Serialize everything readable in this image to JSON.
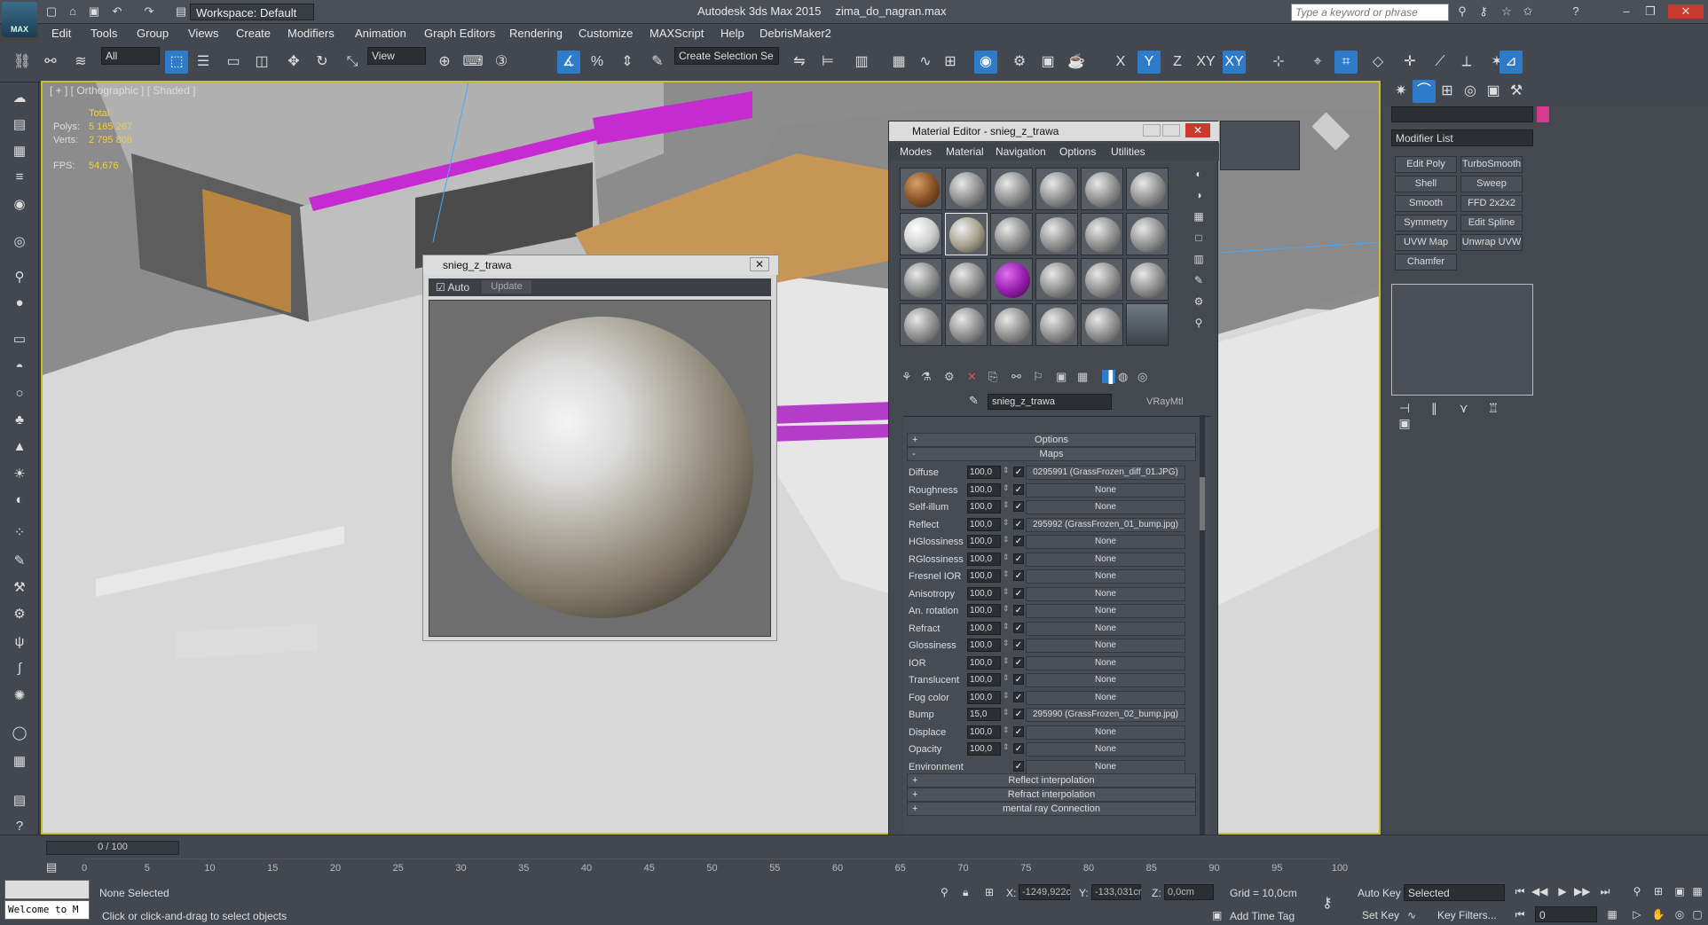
{
  "window": {
    "app_title": "Autodesk 3ds Max 2015",
    "file_name": "zima_do_nagran.max",
    "workspace": "Workspace: Default",
    "search_placeholder": "Type a keyword or phrase",
    "logo_text": "MAX"
  },
  "menus": [
    "Edit",
    "Tools",
    "Group",
    "Views",
    "Create",
    "Modifiers",
    "Animation",
    "Graph Editors",
    "Rendering",
    "Customize",
    "MAXScript",
    "Help",
    "DebrisMaker2"
  ],
  "main_toolbar": {
    "selection_filter": "All",
    "reference_coord": "View",
    "selection_set": "Create Selection Se",
    "axis_x": "X",
    "axis_y": "Y",
    "axis_z": "Z",
    "axis_xy": "XY",
    "axis_xy2": "XY"
  },
  "viewport": {
    "label": "[ + ] [ Orthographic ] [ Shaded ]",
    "stats": {
      "total_label": "Total",
      "polys_label": "Polys:",
      "polys_value": "5 165 267",
      "verts_label": "Verts:",
      "verts_value": "2 795 808",
      "fps_label": "FPS:",
      "fps_value": "54,676"
    }
  },
  "preview_window": {
    "title": "snieg_z_trawa",
    "auto_label": "Auto",
    "update_label": "Update"
  },
  "material_editor": {
    "title": "Material Editor - snieg_z_trawa",
    "menu": [
      "Modes",
      "Material",
      "Navigation",
      "Options",
      "Utilities"
    ],
    "material_name": "snieg_z_trawa",
    "material_type": "VRayMtl",
    "rollout_options": "Options",
    "rollout_maps": "Maps",
    "rollout_reflect_interp": "Reflect interpolation",
    "rollout_refract_interp": "Refract interpolation",
    "rollout_mentalray": "mental ray Connection",
    "maps": [
      {
        "name": "Diffuse",
        "value": "100,0",
        "map": "0295991 (GrassFrozen_diff_01.JPG)"
      },
      {
        "name": "Roughness",
        "value": "100,0",
        "map": "None"
      },
      {
        "name": "Self-illum",
        "value": "100,0",
        "map": "None"
      },
      {
        "name": "Reflect",
        "value": "100,0",
        "map": "295992 (GrassFrozen_01_bump.jpg)"
      },
      {
        "name": "HGlossiness",
        "value": "100,0",
        "map": "None"
      },
      {
        "name": "RGlossiness",
        "value": "100,0",
        "map": "None"
      },
      {
        "name": "Fresnel IOR",
        "value": "100,0",
        "map": "None"
      },
      {
        "name": "Anisotropy",
        "value": "100,0",
        "map": "None"
      },
      {
        "name": "An. rotation",
        "value": "100,0",
        "map": "None"
      },
      {
        "name": "Refract",
        "value": "100,0",
        "map": "None"
      },
      {
        "name": "Glossiness",
        "value": "100,0",
        "map": "None"
      },
      {
        "name": "IOR",
        "value": "100,0",
        "map": "None"
      },
      {
        "name": "Translucent",
        "value": "100,0",
        "map": "None"
      },
      {
        "name": "Fog color",
        "value": "100,0",
        "map": "None"
      },
      {
        "name": "Bump",
        "value": "15,0",
        "map": "295990 (GrassFrozen_02_bump.jpg)"
      },
      {
        "name": "Displace",
        "value": "100,0",
        "map": "None"
      },
      {
        "name": "Opacity",
        "value": "100,0",
        "map": "None"
      },
      {
        "name": "Environment",
        "value": "",
        "map": "None"
      }
    ]
  },
  "command_panel": {
    "modifier_list": "Modifier List",
    "modifier_buttons": [
      "Edit Poly",
      "TurboSmooth",
      "Shell",
      "Sweep",
      "Smooth",
      "FFD 2x2x2",
      "Symmetry",
      "Edit Spline",
      "UVW Map",
      "Unwrap UVW",
      "Chamfer"
    ]
  },
  "timeline": {
    "frame_counter": "0 / 100",
    "ticks": [
      "0",
      "5",
      "10",
      "15",
      "20",
      "25",
      "30",
      "35",
      "40",
      "45",
      "50",
      "55",
      "60",
      "65",
      "70",
      "75",
      "80",
      "85",
      "90",
      "95",
      "100"
    ]
  },
  "status": {
    "welcome": "Welcome to M",
    "selection": "None Selected",
    "prompt": "Click or click-and-drag to select objects",
    "x_label": "X:",
    "x_value": "-1249,922c",
    "y_label": "Y:",
    "y_value": "-133,031cr",
    "z_label": "Z:",
    "z_value": "0,0cm",
    "grid": "Grid = 10,0cm",
    "add_time_tag": "Add Time Tag",
    "auto_key": "Auto Key",
    "set_key": "Set Key",
    "key_mode": "Selected",
    "key_filters": "Key Filters...",
    "frame": "0"
  },
  "colors": {
    "accent": "#2e7cc9",
    "viewport_border": "#c7c02d",
    "object_color": "#d63a8c"
  }
}
